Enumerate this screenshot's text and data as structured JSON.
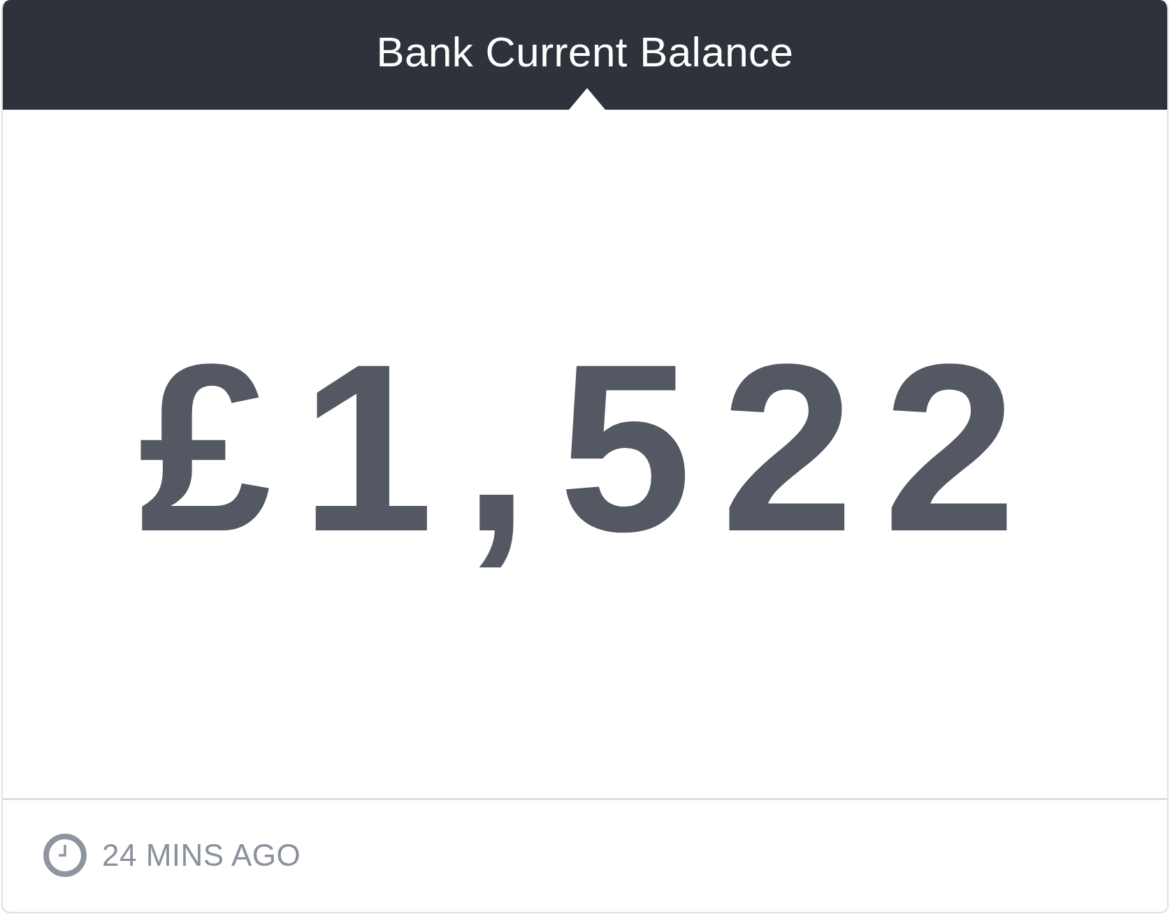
{
  "widget": {
    "title": "Bank Current Balance",
    "value": "£1,522",
    "updated": "24 MINS AGO"
  }
}
